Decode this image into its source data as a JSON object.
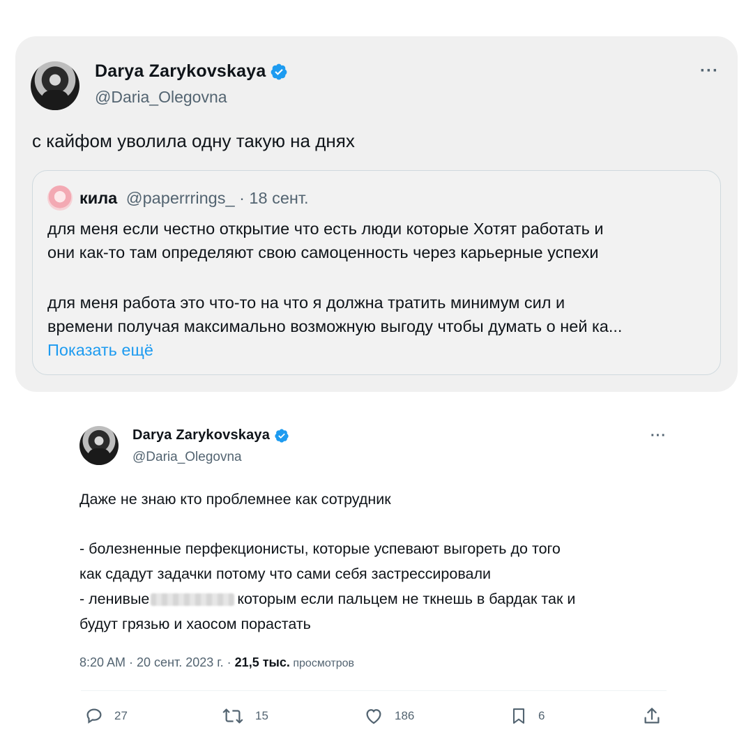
{
  "tweet1": {
    "author_name": "Darya Zarykovskaya",
    "handle": "@Daria_Olegovna",
    "more": "···",
    "text": "с кайфом уволила одну такую на днях",
    "quote": {
      "author_name": "кила",
      "handle_date": "@paperrrings_ · 18 сент.",
      "lines": [
        "для меня если честно открытие что есть люди которые Хотят работать и",
        "они как-то там определяют свою самоценность через карьерные успехи",
        "для меня работа это что-то на что я должна тратить минимум сил и",
        "времени получая максимально возможную выгоду чтобы думать о ней ка..."
      ],
      "show_more": "Показать ещё"
    }
  },
  "tweet2": {
    "author_name": "Darya Zarykovskaya",
    "handle": "@Daria_Olegovna",
    "more": "···",
    "lines": {
      "l1": "Даже не знаю кто проблемнее как сотрудник",
      "l2": "- болезненные перфекционисты, которые успевают выгореть до того",
      "l3": "как сдадут задачки потому что сами себя застрессировали",
      "l4a": "- ленивые",
      "l4b": "которым если пальцем не ткнешь в бардак так и",
      "l5": "будут грязью и хаосом порастать"
    },
    "meta": {
      "time_date": "8:20 AM · 20 сент. 2023 г. · ",
      "views_count": "21,5 тыс.",
      "views_label": " просмотров"
    },
    "actions": {
      "replies": "27",
      "retweets": "15",
      "likes": "186",
      "bookmarks": "6"
    }
  },
  "colors": {
    "accent": "#1d9bf0",
    "text": "#0f1419",
    "muted": "#536471"
  }
}
